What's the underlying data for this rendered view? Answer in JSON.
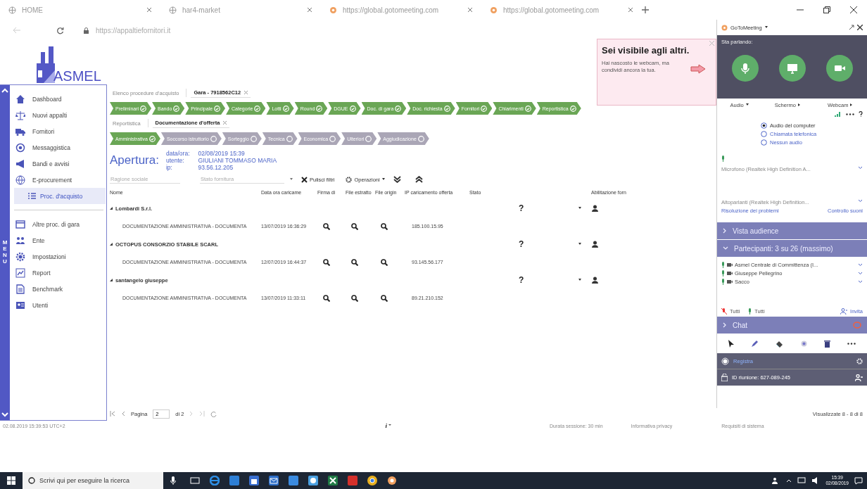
{
  "browser": {
    "tabs": [
      {
        "title": "HOME"
      },
      {
        "title": "har4-market"
      },
      {
        "title": "https://global.gotomeeting.com"
      },
      {
        "title": "https://global.gotomeeting.com"
      }
    ],
    "address": "https://appaltiefornitori.it"
  },
  "sidebar": {
    "logo": "ASMEL",
    "menu_label": "MENU",
    "items": [
      {
        "label": "Dashboard",
        "selected": false
      },
      {
        "label": "Nuovi appalti",
        "selected": false
      },
      {
        "label": "Fornitori",
        "selected": false
      },
      {
        "label": "Messaggistica",
        "selected": false
      },
      {
        "label": "Bandi e avvisi",
        "selected": false
      },
      {
        "label": "E-procurement",
        "selected": false,
        "children": [
          {
            "label": "Proc. d'acquisto",
            "selected": true
          }
        ]
      },
      {
        "label": "Altre proc. di gara",
        "selected": false
      },
      {
        "label": "Ente",
        "selected": false
      },
      {
        "label": "Impostazioni",
        "selected": false
      },
      {
        "label": "Report",
        "selected": false
      },
      {
        "label": "Benchmark",
        "selected": false
      },
      {
        "label": "Utenti",
        "selected": false
      }
    ]
  },
  "content": {
    "breadcrumbs": [
      {
        "label": "Elenco procedure d'acquisto",
        "selected": false,
        "closable": false
      },
      {
        "label": "Gara - 7918562C12",
        "selected": true,
        "closable": true
      }
    ],
    "steps": [
      {
        "label": "Preliminari",
        "done": true
      },
      {
        "label": "Bando",
        "done": true
      },
      {
        "label": "Principale",
        "done": true
      },
      {
        "label": "Categorie",
        "done": true
      },
      {
        "label": "Lotti",
        "done": true
      },
      {
        "label": "Round",
        "done": true
      },
      {
        "label": "DGUE",
        "done": true
      },
      {
        "label": "Doc. di gara",
        "done": true
      },
      {
        "label": "Doc. richiesta",
        "done": true
      },
      {
        "label": "Fornitori",
        "done": true
      },
      {
        "label": "Chiarimenti",
        "done": true
      },
      {
        "label": "Reportistica",
        "done": true
      }
    ],
    "subtabs": [
      {
        "label": "Reportistica",
        "selected": false,
        "closable": false
      },
      {
        "label": "Documentazione d'offerta",
        "selected": true,
        "closable": true
      }
    ],
    "substeps": [
      {
        "label": "Amministrativa",
        "done": true
      },
      {
        "label": "Soccorso istruttorio",
        "done": false
      },
      {
        "label": "Sorteggio",
        "done": false
      },
      {
        "label": "Tecnica",
        "done": false
      },
      {
        "label": "Economica",
        "done": false
      },
      {
        "label": "Ulteriori",
        "done": false
      },
      {
        "label": "Aggiudicazione",
        "done": false
      }
    ],
    "apertura": {
      "title": "Apertura:",
      "fields": [
        {
          "label": "data/ora:",
          "value": "02/08/2019 15:39"
        },
        {
          "label": "utente:",
          "value": "GIULIANI TOMMASO MARIA"
        },
        {
          "label": "ip:",
          "value": "93.56.12.205"
        }
      ]
    },
    "filters": {
      "name_placeholder": "Ragione sociale",
      "status_placeholder": "Stato fornitura",
      "clear_label": "Pulisci filtri",
      "operations_label": "Operazioni"
    },
    "table": {
      "columns": [
        "Nome",
        "Data ora caricame",
        "Firma di",
        "File estratto",
        "File origin",
        "IP caricamento offerta",
        "Stato",
        "Abilitazione forn"
      ],
      "groups": [
        {
          "name": "Lombardi S.r.l.",
          "status": "?",
          "rows": [
            {
              "document": "DOCUMENTAZIONE AMMINISTRATIVA - DOCUMENTA",
              "datetime": "13/07/2019 16:36:29",
              "ip": "185.100.15.95"
            }
          ]
        },
        {
          "name": "OCTOPUS CONSORZIO STABILE SCARL",
          "status": "?",
          "rows": [
            {
              "document": "DOCUMENTAZIONE AMMINISTRATIVA - DOCUMENTA",
              "datetime": "12/07/2019 16:44:37",
              "ip": "93.145.56.177"
            }
          ]
        },
        {
          "name": "santangelo giuseppe",
          "status": "?",
          "rows": [
            {
              "document": "DOCUMENTAZIONE AMMINISTRATIVA - DOCUMENTA",
              "datetime": "13/07/2019 11:33:11",
              "ip": "89.21.210.152"
            }
          ]
        }
      ]
    },
    "pagination": {
      "page_label": "Pagina",
      "page": "2",
      "total_label": "di 2",
      "summary": "Visualizzate 8 - 8 di 8"
    }
  },
  "status_bar": {
    "timestamp": "02.08.2019 15:39:53 UTC+2",
    "info": "i",
    "session": "Durata sessione: 30 min",
    "links": [
      "Informativa privacy",
      "Requisiti di sistema"
    ]
  },
  "taskbar": {
    "search_placeholder": "Scrivi qui per eseguire la ricerca",
    "time": "15:39",
    "date": "02/08/2019"
  },
  "meeting": {
    "title": "GoToMeeting",
    "speaking": "Sta parlando:",
    "controls": [
      "Audio",
      "Schermo",
      "Webcam"
    ],
    "audio_options": [
      {
        "label": "Audio del computer",
        "selected": true
      },
      {
        "label": "Chiamata telefonica",
        "selected": false
      },
      {
        "label": "Nessun audio",
        "selected": false
      }
    ],
    "microphone": "Microfono (Realtek High Definition A...",
    "speakers": "Altoparlanti (Realtek High Definition...",
    "links": [
      "Risoluzione dei problemi",
      "Controllo suoni"
    ],
    "audience": {
      "label": "Vista audience",
      "expanded": false
    },
    "participants": {
      "label": "Partecipanti: 3 su 26 (massimo)",
      "expanded": true,
      "items": [
        {
          "name": "Asmel Centrale di Committenza (I..."
        },
        {
          "name": "Giuseppe Pellegrino"
        },
        {
          "name": "Sacco"
        }
      ]
    },
    "mute_all": "Tutti",
    "unmute_all": "Tutti",
    "invite": "Invita",
    "chat": {
      "label": "Chat",
      "expanded": false
    },
    "record": "Registra",
    "meeting_id": "ID riunione: 627-089-245"
  },
  "tooltip": {
    "title": "Sei visibile agli altri.",
    "text": "Hai nascosto le webcam, ma condividi ancora la tua."
  }
}
